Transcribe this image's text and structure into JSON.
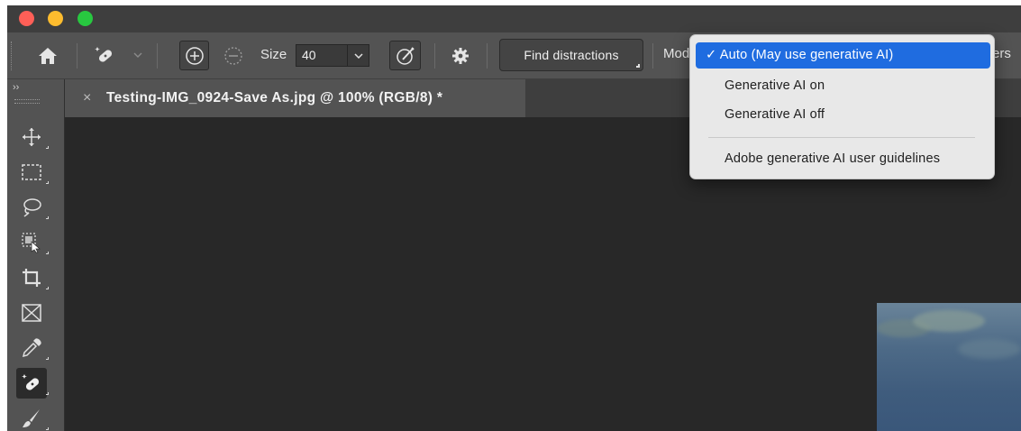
{
  "window": {
    "traffic_lights": [
      "close",
      "minimize",
      "zoom"
    ]
  },
  "options_bar": {
    "size_label": "Size",
    "size_value": "40",
    "find_distractions_label": "Find distractions",
    "mode_label_partial": "Mod",
    "trailing_label_partial": "ers"
  },
  "toolbox": {
    "collapse_label": "››",
    "tools": [
      "move-icon",
      "marquee-icon",
      "lasso-icon",
      "object-selection-icon",
      "crop-icon",
      "frame-icon",
      "eyedropper-icon",
      "remove-tool-icon",
      "brush-icon"
    ],
    "active_tool": "remove-tool-icon"
  },
  "document_tab": {
    "close_symbol": "×",
    "title": "Testing-IMG_0924-Save As.jpg @ 100% (RGB/8) *"
  },
  "mode_menu": {
    "items": [
      {
        "label": "✓ Auto (May use generative AI)",
        "selected": true
      },
      {
        "label": "Generative AI on",
        "selected": false
      },
      {
        "label": "Generative AI off",
        "selected": false
      },
      {
        "label": "Adobe generative AI user guidelines",
        "selected": false
      }
    ],
    "accent_color": "#1f6ce0"
  }
}
